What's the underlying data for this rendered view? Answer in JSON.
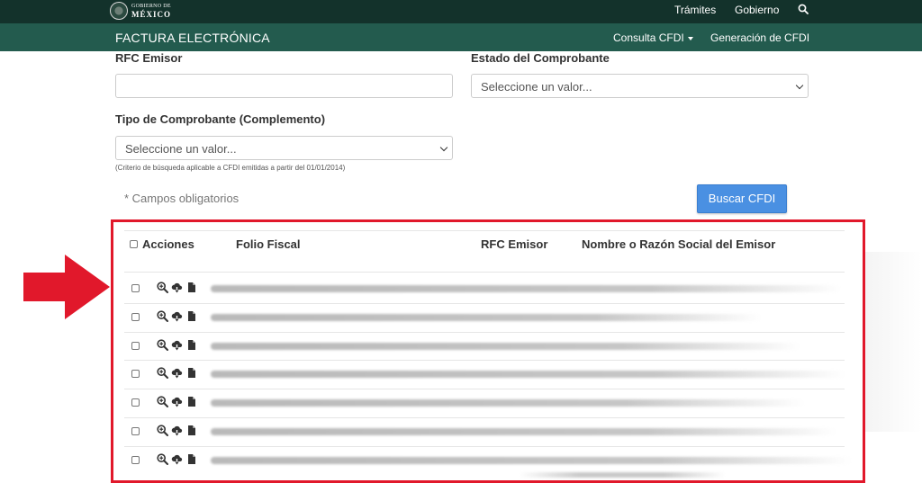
{
  "gov_logo": {
    "line1": "GOBIERNO DE",
    "line2": "MÉXICO"
  },
  "topnav": {
    "tramites": "Trámites",
    "gobierno": "Gobierno"
  },
  "subnav": {
    "brand": "FACTURA ELECTRÓNICA",
    "consulta": "Consulta CFDI",
    "generacion": "Generación de CFDI"
  },
  "form": {
    "rfc_emisor_label": "RFC Emisor",
    "rfc_emisor_value": "",
    "estado_label": "Estado del Comprobante",
    "estado_value": "Seleccione un valor...",
    "tipo_label": "Tipo de Comprobante (Complemento)",
    "tipo_value": "Seleccione un valor...",
    "tipo_hint": "(Criterio de búsqueda aplicable a CFDI emitidas a partir del 01/01/2014)",
    "required_note": "* Campos obligatorios",
    "search_button": "Buscar CFDI"
  },
  "results": {
    "columns": [
      "Acciones",
      "Folio Fiscal",
      "RFC Emisor",
      "Nombre o Razón Social del Emisor"
    ],
    "row_count": 7,
    "highlight_color": "#e1182b"
  },
  "colors": {
    "topbar": "#13322b",
    "subbar": "#235b4e",
    "button": "#4a90e2",
    "arrow": "#e1182b"
  },
  "icons": [
    "search-icon",
    "zoom-in-icon",
    "cloud-download-icon",
    "file-icon",
    "arrow-right-icon"
  ]
}
